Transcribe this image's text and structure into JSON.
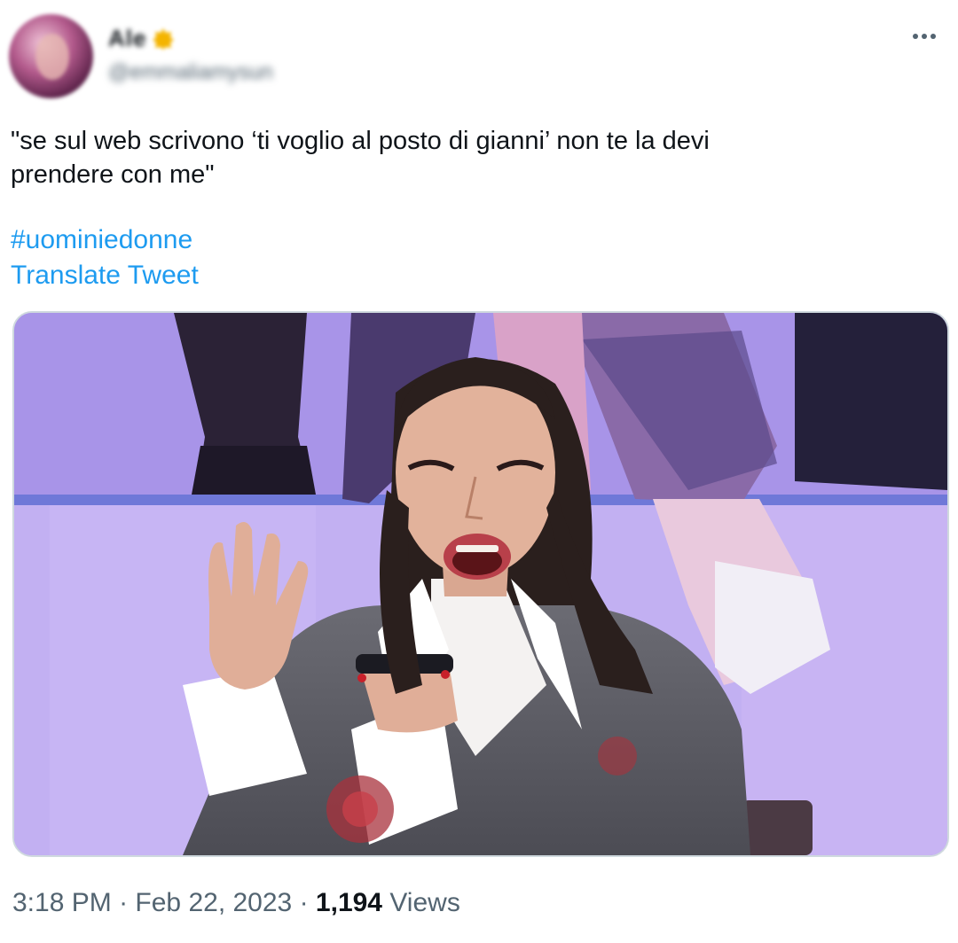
{
  "author": {
    "display_name": "Ale",
    "handle": "@emmaliamysun",
    "avatar_icon": "avatar-photo",
    "verified_icon": "verified-badge-icon",
    "verified_color": "#f4b400"
  },
  "tweet": {
    "text": "\"se sul web scrivono ‘ti voglio al posto di gianni’ non te la devi\nprendere con me\"",
    "hashtag": "#uominiedonne",
    "translate_label": "Translate Tweet",
    "media_icon": "photo-woman-on-phone"
  },
  "meta": {
    "time": "3:18 PM",
    "separator": "·",
    "date": "Feb 22, 2023",
    "views_count": "1,194",
    "views_label": "Views"
  },
  "colors": {
    "link": "#1d9bf0",
    "text": "#0f1419",
    "secondary": "#536471",
    "border": "#cfd9de"
  }
}
